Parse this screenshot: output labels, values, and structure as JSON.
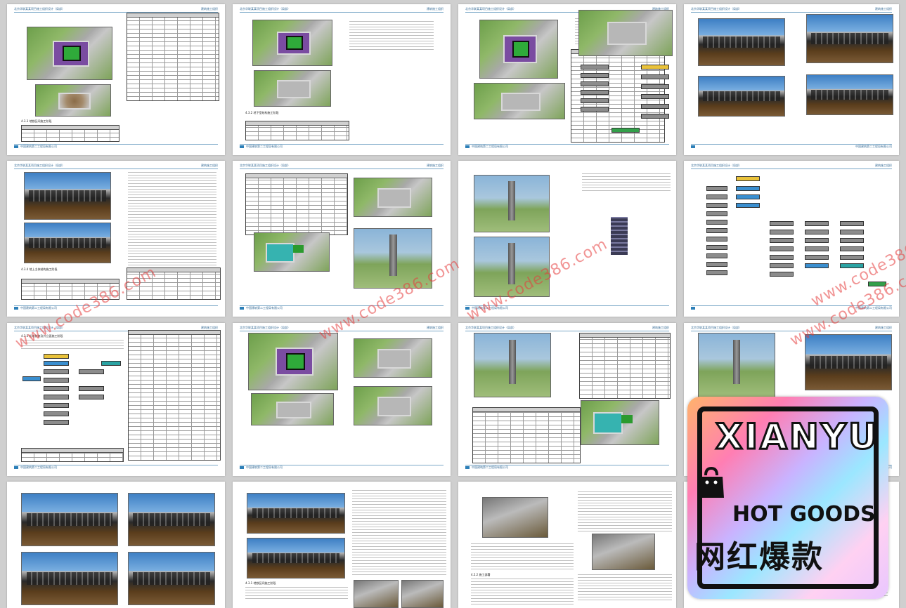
{
  "viewer": {
    "title": "document thumbnail grid"
  },
  "header_left": "北京华联某某项目施工组织设计（局部）",
  "header_right": "建筑施工组织",
  "footer_text": "中国建筑第二工程局有限公司",
  "sections": {
    "p1": "4.3.3 地铁区间施工阶段",
    "p2": "4.3.2 地下室结构施工阶段",
    "p5": "4.3.4 地上主体结构施工阶段",
    "p9": "4.3.5 机电装修及外立面施工阶段",
    "p18": "4.3.1 地铁区间施工阶段",
    "p19": "4.2.2 施工部署"
  },
  "watermarks": [
    "www.code386.com",
    "www.code386.com",
    "www.code386.com",
    "www.code386.com",
    "www.code386.com"
  ],
  "ad": {
    "brand": "XIANYU",
    "tagline": "HOT GOODS",
    "chinese": "网红爆款"
  },
  "colors": {
    "accent": "#2c7fb8",
    "watermark": "#e63c3c"
  }
}
